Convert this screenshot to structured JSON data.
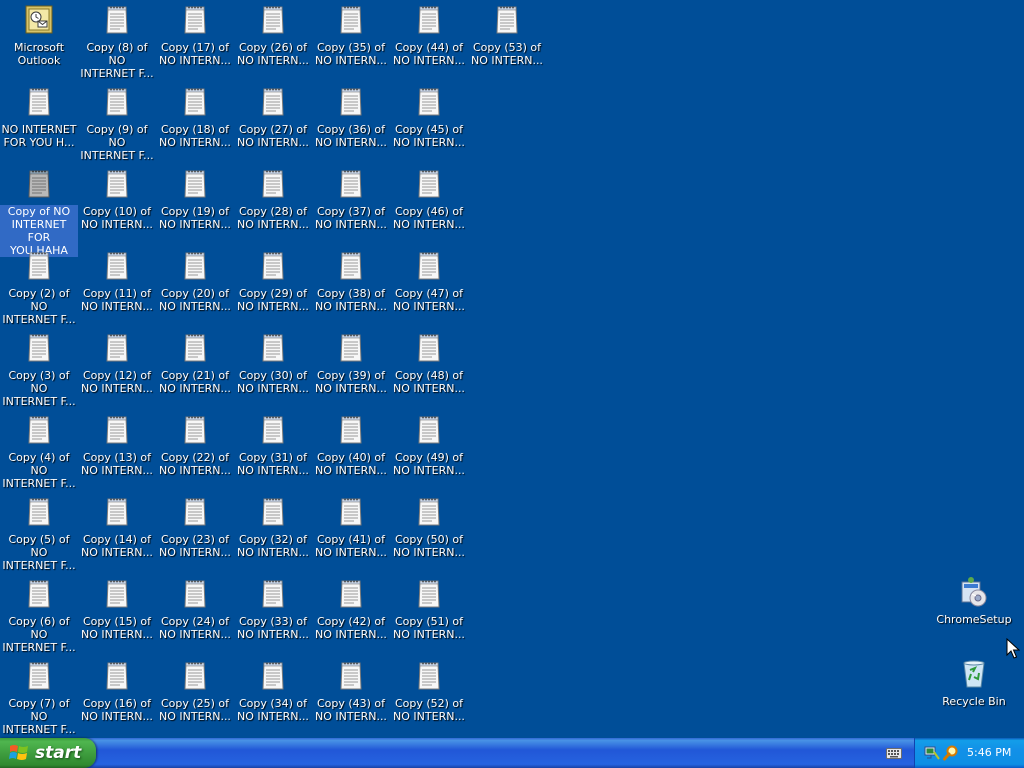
{
  "desktop": {
    "columns": [
      [
        {
          "label": "Microsoft\nOutlook",
          "icon": "outlook-icon"
        },
        {
          "label": "NO INTERNET\nFOR YOU H...",
          "icon": "notepad-icon"
        },
        {
          "label": "Copy of NO\nINTERNET FOR\nYOU HAHA",
          "icon": "notepad-icon",
          "selected": true
        },
        {
          "label": "Copy (2) of NO\nINTERNET F...",
          "icon": "notepad-icon"
        },
        {
          "label": "Copy (3) of NO\nINTERNET F...",
          "icon": "notepad-icon"
        },
        {
          "label": "Copy (4) of NO\nINTERNET F...",
          "icon": "notepad-icon"
        },
        {
          "label": "Copy (5) of NO\nINTERNET F...",
          "icon": "notepad-icon"
        },
        {
          "label": "Copy (6) of NO\nINTERNET F...",
          "icon": "notepad-icon"
        },
        {
          "label": "Copy (7) of NO\nINTERNET F...",
          "icon": "notepad-icon"
        }
      ],
      [
        {
          "label": "Copy (8) of NO\nINTERNET F...",
          "icon": "notepad-icon"
        },
        {
          "label": "Copy (9) of NO\nINTERNET F...",
          "icon": "notepad-icon"
        },
        {
          "label": "Copy (10) of\nNO INTERN...",
          "icon": "notepad-icon"
        },
        {
          "label": "Copy (11) of\nNO INTERN...",
          "icon": "notepad-icon"
        },
        {
          "label": "Copy (12) of\nNO INTERN...",
          "icon": "notepad-icon"
        },
        {
          "label": "Copy (13) of\nNO INTERN...",
          "icon": "notepad-icon"
        },
        {
          "label": "Copy (14) of\nNO INTERN...",
          "icon": "notepad-icon"
        },
        {
          "label": "Copy (15) of\nNO INTERN...",
          "icon": "notepad-icon"
        },
        {
          "label": "Copy (16) of\nNO INTERN...",
          "icon": "notepad-icon"
        }
      ],
      [
        {
          "label": "Copy (17) of\nNO INTERN...",
          "icon": "notepad-icon"
        },
        {
          "label": "Copy (18) of\nNO INTERN...",
          "icon": "notepad-icon"
        },
        {
          "label": "Copy (19) of\nNO INTERN...",
          "icon": "notepad-icon"
        },
        {
          "label": "Copy (20) of\nNO INTERN...",
          "icon": "notepad-icon"
        },
        {
          "label": "Copy (21) of\nNO INTERN...",
          "icon": "notepad-icon"
        },
        {
          "label": "Copy (22) of\nNO INTERN...",
          "icon": "notepad-icon"
        },
        {
          "label": "Copy (23) of\nNO INTERN...",
          "icon": "notepad-icon"
        },
        {
          "label": "Copy (24) of\nNO INTERN...",
          "icon": "notepad-icon"
        },
        {
          "label": "Copy (25) of\nNO INTERN...",
          "icon": "notepad-icon"
        }
      ],
      [
        {
          "label": "Copy (26) of\nNO INTERN...",
          "icon": "notepad-icon"
        },
        {
          "label": "Copy (27) of\nNO INTERN...",
          "icon": "notepad-icon"
        },
        {
          "label": "Copy (28) of\nNO INTERN...",
          "icon": "notepad-icon"
        },
        {
          "label": "Copy (29) of\nNO INTERN...",
          "icon": "notepad-icon"
        },
        {
          "label": "Copy (30) of\nNO INTERN...",
          "icon": "notepad-icon"
        },
        {
          "label": "Copy (31) of\nNO INTERN...",
          "icon": "notepad-icon"
        },
        {
          "label": "Copy (32) of\nNO INTERN...",
          "icon": "notepad-icon"
        },
        {
          "label": "Copy (33) of\nNO INTERN...",
          "icon": "notepad-icon"
        },
        {
          "label": "Copy (34) of\nNO INTERN...",
          "icon": "notepad-icon"
        }
      ],
      [
        {
          "label": "Copy (35) of\nNO INTERN...",
          "icon": "notepad-icon"
        },
        {
          "label": "Copy (36) of\nNO INTERN...",
          "icon": "notepad-icon"
        },
        {
          "label": "Copy (37) of\nNO INTERN...",
          "icon": "notepad-icon"
        },
        {
          "label": "Copy (38) of\nNO INTERN...",
          "icon": "notepad-icon"
        },
        {
          "label": "Copy (39) of\nNO INTERN...",
          "icon": "notepad-icon"
        },
        {
          "label": "Copy (40) of\nNO INTERN...",
          "icon": "notepad-icon"
        },
        {
          "label": "Copy (41) of\nNO INTERN...",
          "icon": "notepad-icon"
        },
        {
          "label": "Copy (42) of\nNO INTERN...",
          "icon": "notepad-icon"
        },
        {
          "label": "Copy (43) of\nNO INTERN...",
          "icon": "notepad-icon"
        }
      ],
      [
        {
          "label": "Copy (44) of\nNO INTERN...",
          "icon": "notepad-icon"
        },
        {
          "label": "Copy (45) of\nNO INTERN...",
          "icon": "notepad-icon"
        },
        {
          "label": "Copy (46) of\nNO INTERN...",
          "icon": "notepad-icon"
        },
        {
          "label": "Copy (47) of\nNO INTERN...",
          "icon": "notepad-icon"
        },
        {
          "label": "Copy (48) of\nNO INTERN...",
          "icon": "notepad-icon"
        },
        {
          "label": "Copy (49) of\nNO INTERN...",
          "icon": "notepad-icon"
        },
        {
          "label": "Copy (50) of\nNO INTERN...",
          "icon": "notepad-icon"
        },
        {
          "label": "Copy (51) of\nNO INTERN...",
          "icon": "notepad-icon"
        },
        {
          "label": "Copy (52) of\nNO INTERN...",
          "icon": "notepad-icon"
        }
      ],
      [
        {
          "label": "Copy (53) of\nNO INTERN...",
          "icon": "notepad-icon"
        }
      ]
    ],
    "right_icons": [
      {
        "label": "ChromeSetup",
        "icon": "chrome-setup-icon"
      },
      {
        "label": "Recycle Bin",
        "icon": "recycle-bin-icon"
      }
    ]
  },
  "taskbar": {
    "start_label": "start",
    "clock": "5:46 PM",
    "tray_icons": [
      "network-icon",
      "search-icon"
    ],
    "language_icon": "keyboard-icon"
  },
  "colors": {
    "desktop": "#004e98",
    "taskbar": "#2157d7",
    "start": "#3d9b3d",
    "tray": "#1290e8",
    "selection": "#316ac5"
  }
}
